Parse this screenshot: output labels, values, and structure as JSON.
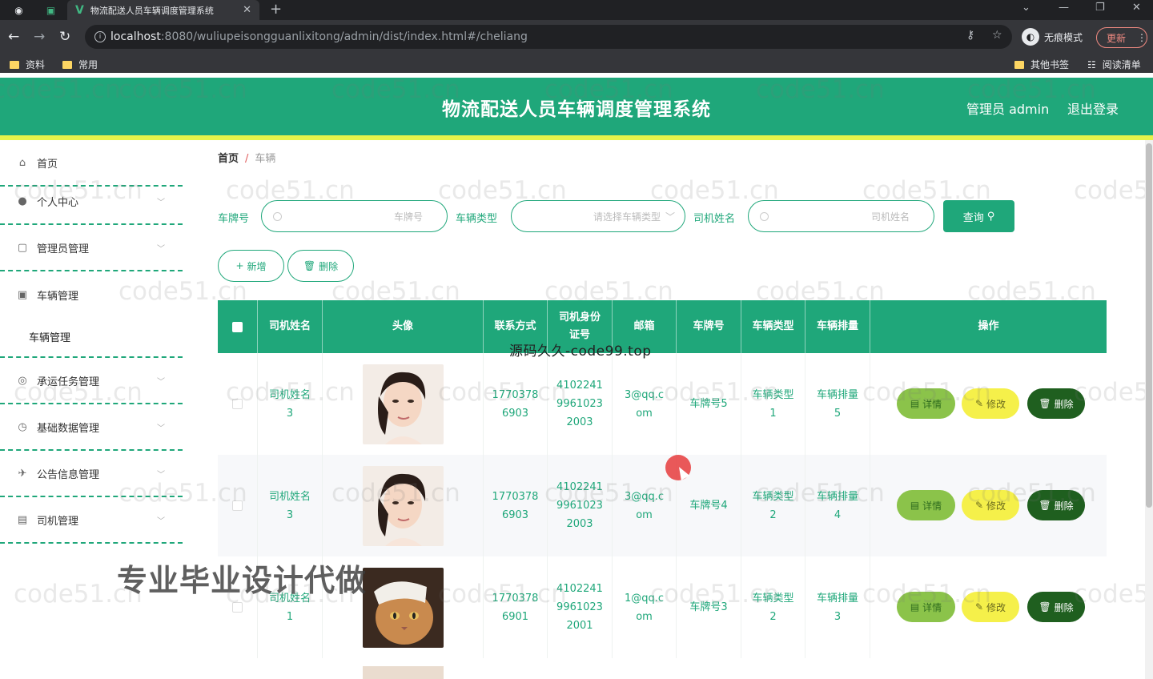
{
  "browser": {
    "tab_title": "物流配送人员车辆调度管理系统",
    "url_host": "localhost",
    "url_path": ":8080/wuliupeisongguanlixitong/admin/dist/index.html#/cheliang",
    "incognito_label": "无痕模式",
    "update_label": "更新",
    "bookmarks": [
      "资料",
      "常用"
    ],
    "bookmarks_right": [
      "其他书签",
      "阅读清单"
    ]
  },
  "header": {
    "title": "物流配送人员车辆调度管理系统",
    "admin": "管理员 admin",
    "logout": "退出登录"
  },
  "sidebar": {
    "items": [
      {
        "label": "首页",
        "icon": "home-icon"
      },
      {
        "label": "个人中心",
        "icon": "user-icon"
      },
      {
        "label": "管理员管理",
        "icon": "admin-icon"
      },
      {
        "label": "车辆管理",
        "icon": "vehicle-icon"
      },
      {
        "label": "承运任务管理",
        "icon": "task-icon"
      },
      {
        "label": "基础数据管理",
        "icon": "data-icon"
      },
      {
        "label": "公告信息管理",
        "icon": "notice-icon"
      },
      {
        "label": "司机管理",
        "icon": "driver-icon"
      }
    ],
    "sub_item": "车辆管理"
  },
  "breadcrumb": {
    "home": "首页",
    "sep": "/",
    "current": "车辆"
  },
  "filters": {
    "plate_label": "车牌号",
    "plate_placeholder": "车牌号",
    "type_label": "车辆类型",
    "type_placeholder": "请选择车辆类型",
    "driver_label": "司机姓名",
    "driver_placeholder": "司机姓名",
    "search_button": "查询"
  },
  "actions": {
    "add": "新增",
    "delete": "删除"
  },
  "table": {
    "headers": [
      "司机姓名",
      "头像",
      "联系方式",
      "司机身份证号",
      "邮箱",
      "车牌号",
      "车辆类型",
      "车辆排量",
      "操作"
    ],
    "header_idcard_lines": [
      "司机身份",
      "证号"
    ],
    "rows": [
      {
        "name": [
          "司机姓名",
          "3"
        ],
        "phone": [
          "1770378",
          "6903"
        ],
        "idcard": [
          "4102241",
          "9961023",
          "2003"
        ],
        "email": [
          "3@qq.c",
          "om"
        ],
        "plate": "车牌号5",
        "type": [
          "车辆类型",
          "1"
        ],
        "disp": [
          "车辆排量",
          "5"
        ]
      },
      {
        "name": [
          "司机姓名",
          "3"
        ],
        "phone": [
          "1770378",
          "6903"
        ],
        "idcard": [
          "4102241",
          "9961023",
          "2003"
        ],
        "email": [
          "3@qq.c",
          "om"
        ],
        "plate": "车牌号4",
        "type": [
          "车辆类型",
          "2"
        ],
        "disp": [
          "车辆排量",
          "4"
        ]
      },
      {
        "name": [
          "司机姓名",
          "1"
        ],
        "phone": [
          "1770378",
          "6901"
        ],
        "idcard": [
          "4102241",
          "9961023",
          "2001"
        ],
        "email": [
          "1@qq.c",
          "om"
        ],
        "plate": "车牌号3",
        "type": [
          "车辆类型",
          "2"
        ],
        "disp": [
          "车辆排量",
          "3"
        ]
      }
    ],
    "row_buttons": {
      "detail": "详情",
      "edit": "修改",
      "delete": "删除"
    }
  },
  "overlays": {
    "source_text": "源码久久-code99.top",
    "ad_text": "专业毕业设计代做",
    "watermark": "code51.cn"
  }
}
